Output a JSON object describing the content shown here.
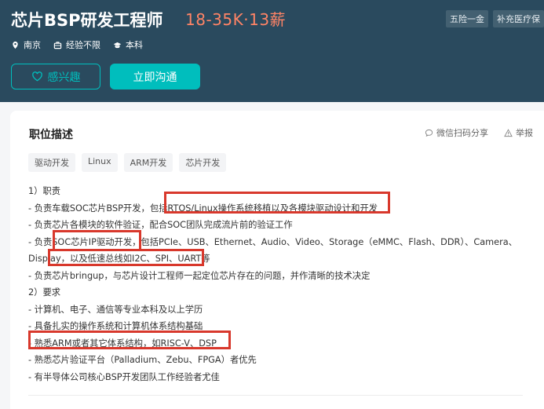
{
  "job": {
    "title": "芯片BSP研发工程师",
    "salary": "18-35K·13薪",
    "benefits": [
      "五险一金",
      "补充医疗保"
    ]
  },
  "meta": {
    "location": "南京",
    "experience": "经验不限",
    "education": "本科"
  },
  "buttons": {
    "interest": "感兴趣",
    "chat": "立即沟通"
  },
  "section": {
    "title": "职位描述",
    "share": "微信扫码分享",
    "report": "举报"
  },
  "skills": [
    "驱动开发",
    "Linux",
    "ARM开发",
    "芯片开发"
  ],
  "description": [
    "1）职责",
    "- 负责车载SOC芯片BSP开发，包括RTOS/Linux操作系统移植以及各模块驱动设计和开发",
    "- 负责芯片各模块的软件验证，配合SOC团队完成流片前的验证工作",
    "- 负责SOC芯片IP驱动开发，包括PCIe、USB、Ethernet、Audio、Video、Storage（eMMC、Flash、DDR）、Camera、Display，以及低速总线如I2C、SPI、UART等",
    "- 负责芯片bringup，与芯片设计工程师一起定位芯片存在的问题，并作清晰的技术决定",
    "2）要求",
    "- 计算机、电子、通信等专业本科及以上学历",
    "- 具备扎实的操作系统和计算机体系结构基础",
    "- 熟悉ARM或者其它体系结构，如RISC-V、DSP",
    "- 熟悉芯片验证平台（Palladium、Zebu、FPGA）者优先",
    "- 有半导体公司核心BSP开发团队工作经验者尤佳"
  ],
  "colors": {
    "header_bg": "#2a4a5e",
    "accent": "#00bebd",
    "salary": "#ff8466",
    "highlight_box": "#d8382c"
  }
}
